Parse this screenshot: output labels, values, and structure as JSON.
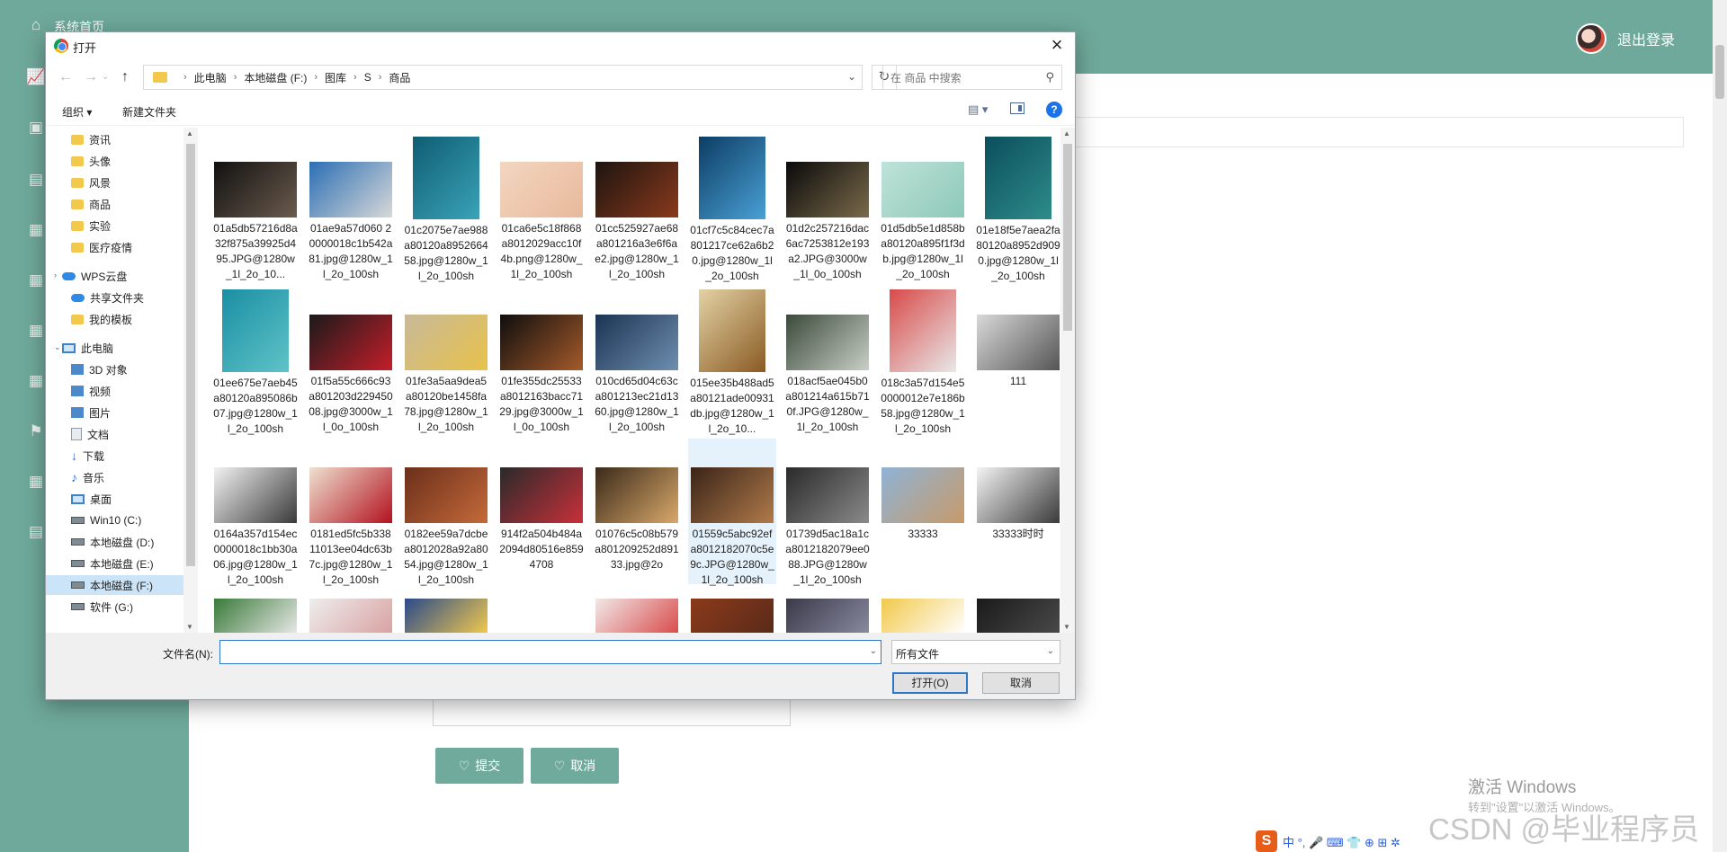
{
  "app": {
    "home_label": "系统首页",
    "logout": "退出登录",
    "submit_label": "提交",
    "cancel_label": "取消",
    "activate_title": "激活 Windows",
    "activate_sub": "转到\"设置\"以激活 Windows。",
    "watermark": "CSDN @毕业程序员",
    "ime_text": "中 °, 🎤 ⌨ 👕 ⊕ ⊞ ✲"
  },
  "dialog": {
    "title": "打开",
    "breadcrumbs": [
      "此电脑",
      "本地磁盘 (F:)",
      "图库",
      "S",
      "商品"
    ],
    "search_placeholder": "在 商品 中搜索",
    "toolbar": {
      "organize": "组织 ▾",
      "new_folder": "新建文件夹"
    },
    "nav_items": [
      {
        "label": "资讯",
        "icon": "folder-icon",
        "pinned": true
      },
      {
        "label": "头像",
        "icon": "folder-icon",
        "pinned": true
      },
      {
        "label": "风景",
        "icon": "folder-icon",
        "pinned": false
      },
      {
        "label": "商品",
        "icon": "folder-icon",
        "pinned": false
      },
      {
        "label": "实验",
        "icon": "folder-icon",
        "pinned": false
      },
      {
        "label": "医疗疫情",
        "icon": "folder-icon",
        "pinned": false
      },
      {
        "label": "WPS云盘",
        "icon": "cloud-icon",
        "pinned": false
      },
      {
        "label": "共享文件夹",
        "icon": "share-icon",
        "pinned": false
      },
      {
        "label": "我的模板",
        "icon": "folder-icon",
        "pinned": false
      },
      {
        "label": "此电脑",
        "icon": "computer-icon",
        "pinned": false
      },
      {
        "label": "3D 对象",
        "icon": "cube-icon",
        "pinned": false
      },
      {
        "label": "视频",
        "icon": "video-icon",
        "pinned": false
      },
      {
        "label": "图片",
        "icon": "picture-icon",
        "pinned": false
      },
      {
        "label": "文档",
        "icon": "document-icon",
        "pinned": false
      },
      {
        "label": "下载",
        "icon": "download-icon",
        "pinned": false
      },
      {
        "label": "音乐",
        "icon": "music-icon",
        "pinned": false
      },
      {
        "label": "桌面",
        "icon": "desktop-icon",
        "pinned": false
      },
      {
        "label": "Win10 (C:)",
        "icon": "drive-icon",
        "pinned": false
      },
      {
        "label": "本地磁盘 (D:)",
        "icon": "drive-icon",
        "pinned": false
      },
      {
        "label": "本地磁盘 (E:)",
        "icon": "drive-icon",
        "pinned": false
      },
      {
        "label": "本地磁盘 (F:)",
        "icon": "drive-icon",
        "pinned": false
      },
      {
        "label": "软件 (G:)",
        "icon": "drive-icon",
        "pinned": false
      }
    ],
    "files": [
      {
        "name": "01a5db57216d8a32f875a39925d495.JPG@1280w_1l_2o_10...",
        "colors": [
          "#111111",
          "#6b5b4d"
        ]
      },
      {
        "name": "01ae9a57d060 20000018c1b542a81.jpg@1280w_1l_2o_100sh",
        "colors": [
          "#2b6fb4",
          "#d8d8d8"
        ]
      },
      {
        "name": "01c2075e7ae988a80120a895266458.jpg@1280w_1l_2o_100sh",
        "colors": [
          "#0f5d72",
          "#3aa3b8"
        ]
      },
      {
        "name": "01ca6e5c18f868a8012029acc10f4b.png@1280w_1l_2o_100sh",
        "colors": [
          "#f3d6c1",
          "#e8b99b"
        ]
      },
      {
        "name": "01cc525927ae68a801216a3e6f6ae2.jpg@1280w_1l_2o_100sh",
        "colors": [
          "#1d1410",
          "#8a3a1c"
        ]
      },
      {
        "name": "01cf7c5c84cec7a801217ce62a6b20.jpg@1280w_1l_2o_100sh",
        "colors": [
          "#0c3d63",
          "#4aa0d6"
        ]
      },
      {
        "name": "01d2c257216dac6ac7253812e193a2.JPG@3000w_1l_0o_100sh",
        "colors": [
          "#0a0a0a",
          "#7a6a4a"
        ]
      },
      {
        "name": "01d5db5e1d858ba80120a895f1f3db.jpg@1280w_1l_2o_100sh",
        "colors": [
          "#bfe3d8",
          "#8cc9b8"
        ]
      },
      {
        "name": "01e18f5e7aea2fa80120a8952d9090.jpg@1280w_1l_2o_100sh",
        "colors": [
          "#0b4e5c",
          "#2e8c8a"
        ]
      },
      {
        "name": "01ee675e7aeb45a80120a895086b07.jpg@1280w_1l_2o_100sh",
        "colors": [
          "#1a8fa3",
          "#5fc3c8"
        ]
      },
      {
        "name": "01f5a55c666c93a801203d22945008.jpg@3000w_1l_0o_100sh",
        "colors": [
          "#1a1a1a",
          "#c41e2a"
        ]
      },
      {
        "name": "01fe3a5aa9dea5a80120be1458fa78.jpg@1280w_1l_2o_100sh",
        "colors": [
          "#c8b99a",
          "#e8c24a"
        ]
      },
      {
        "name": "01fe355dc25533a8012163bacc7129.jpg@3000w_1l_0o_100sh",
        "colors": [
          "#0e0e0e",
          "#a55a2a"
        ]
      },
      {
        "name": "010cd65d04c63ca801213ec21d1360.jpg@1280w_1l_2o_100sh",
        "colors": [
          "#1b3352",
          "#6f8fb0"
        ]
      },
      {
        "name": "015ee35b488ad5a80121ade00931db.jpg@1280w_1l_2o_10...",
        "colors": [
          "#e3d2a5",
          "#8a5a22"
        ]
      },
      {
        "name": "018acf5ae045b0a801214a615b710f.JPG@1280w_1l_2o_100sh",
        "colors": [
          "#3a4a3a",
          "#c9cfc6"
        ]
      },
      {
        "name": "018c3a57d154e50000012e7e186b58.jpg@1280w_1l_2o_100sh",
        "colors": [
          "#d94a4a",
          "#e8e8e8"
        ]
      },
      {
        "name": "111",
        "colors": [
          "#d9d9d9",
          "#555555"
        ]
      },
      {
        "name": "0164a357d154ec0000018c1bb30a06.jpg@1280w_1l_2o_100sh",
        "colors": [
          "#f2f2f2",
          "#3a3a3a"
        ]
      },
      {
        "name": "0181ed5fc5b33811013ee04dc63b7c.jpg@1280w_1l_2o_100sh",
        "colors": [
          "#efe1d0",
          "#b3121f"
        ]
      },
      {
        "name": "0182ee59a7dcbea8012028a92a8054.jpg@1280w_1l_2o_100sh",
        "colors": [
          "#6b2f1a",
          "#c46a3a"
        ]
      },
      {
        "name": "914f2a504b484a2094d80516e8594708",
        "colors": [
          "#2a2a2a",
          "#c7303a"
        ]
      },
      {
        "name": "01076c5c08b579a801209252d89133.jpg@2o",
        "colors": [
          "#3a2a1a",
          "#d9a86a"
        ]
      },
      {
        "name": "01559c5abc92efa8012182070c5e9c.JPG@1280w_1l_2o_100sh",
        "colors": [
          "#3a2418",
          "#b07a4a"
        ]
      },
      {
        "name": "01739d5ac18a1ca8012182079ee088.JPG@1280w_1l_2o_100sh",
        "colors": [
          "#2a2a2a",
          "#8a8a8a"
        ]
      },
      {
        "name": "33333",
        "colors": [
          "#8fb3d6",
          "#c79a6a"
        ]
      },
      {
        "name": "33333时时",
        "colors": [
          "#f4f4f4",
          "#3a3a3a"
        ]
      }
    ],
    "partial_row": [
      {
        "colors": [
          "#3a7a3a",
          "#e8e8e8"
        ]
      },
      {
        "colors": [
          "#eeeeee",
          "#d9a0a0"
        ]
      },
      {
        "colors": [
          "#2a4a8a",
          "#f2c94c"
        ]
      },
      {
        "colors": [
          "#ffffff",
          "#ffffff"
        ]
      },
      {
        "colors": [
          "#f2e8e8",
          "#d94a4a"
        ]
      },
      {
        "colors": [
          "#8a3a1a",
          "#5a2a1a"
        ]
      },
      {
        "colors": [
          "#3a3a4a",
          "#8a8aa0"
        ]
      },
      {
        "colors": [
          "#f2c94c",
          "#ffffff"
        ]
      },
      {
        "colors": [
          "#1a1a1a",
          "#4a4a4a"
        ]
      },
      {
        "colors": [
          "#5a2a2a",
          "#c94a4a"
        ]
      }
    ],
    "filename_label": "文件名(N):",
    "filename_value": "",
    "filter_value": "所有文件",
    "open_label": "打开(O)",
    "cancel_label": "取消"
  }
}
